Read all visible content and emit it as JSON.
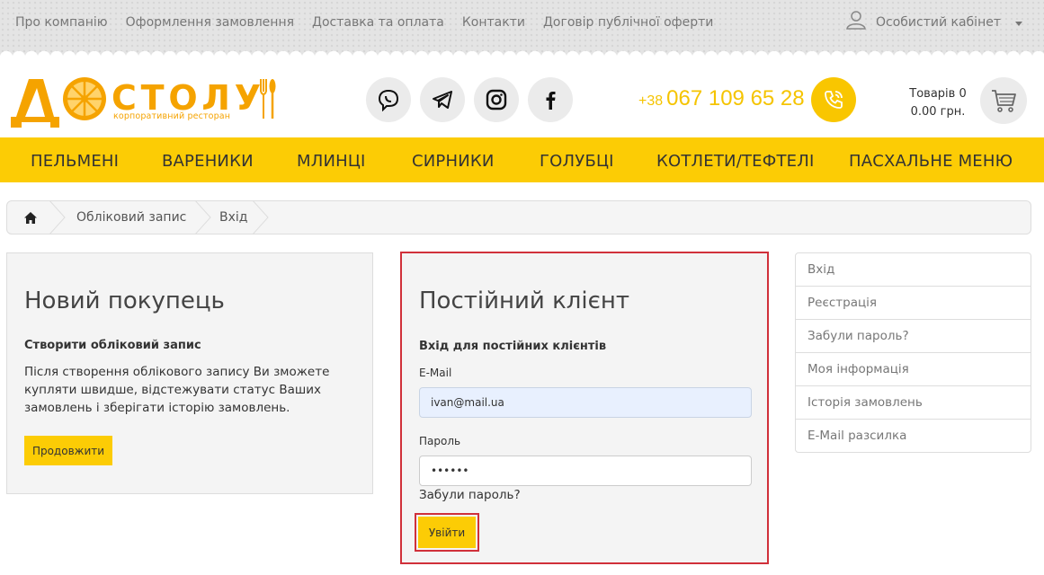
{
  "topnav": {
    "items": [
      "Про компанію",
      "Оформлення замовлення",
      "Доставка та оплата",
      "Контакти",
      "Договір публічної оферти"
    ],
    "account_label": "Особистий кабінет"
  },
  "logo": {
    "text": "ДОСТОЛУ",
    "tagline": "корпоративний ресторан"
  },
  "social": [
    "viber-icon",
    "telegram-icon",
    "instagram-icon",
    "facebook-icon"
  ],
  "phone": {
    "code": "+38",
    "number": "067 109 65 28"
  },
  "cart": {
    "items_label": "Товарів 0",
    "total": "0.00 грн."
  },
  "menu": [
    "ПЕЛЬМЕНІ",
    "ВАРЕНИКИ",
    "МЛИНЦІ",
    "СИРНИКИ",
    "ГОЛУБЦІ",
    "КОТЛЕТИ/ТЕФТЕЛІ",
    "ПАСХАЛЬНЕ МЕНЮ"
  ],
  "breadcrumb": [
    "Обліковий запис",
    "Вхід"
  ],
  "new_customer": {
    "title": "Новий покупець",
    "subtitle": "Створити обліковий запис",
    "text_lines": [
      "Після створення облікового запису Ви зможете",
      "купляти швидше, відстежувати статус Ваших",
      "замовлень і зберігати історію замовлень."
    ],
    "button": "Продовжити"
  },
  "returning": {
    "title": "Постійний клієнт",
    "subtitle": "Вхід для постійних клієнтів",
    "email_label": "E-Mail",
    "email_value": "ivan@mail.ua",
    "password_label": "Пароль",
    "password_value": "••••••",
    "forgot": "Забули пароль?",
    "login_button": "Увійти"
  },
  "sidebar": [
    "Вхід",
    "Реєстрація",
    "Забули пароль?",
    "Моя інформація",
    "Історія замовлень",
    "E-Mail разсилка"
  ],
  "colors": {
    "accent": "#fccc05",
    "highlight": "#d0303a",
    "phone": "#f5c400"
  }
}
